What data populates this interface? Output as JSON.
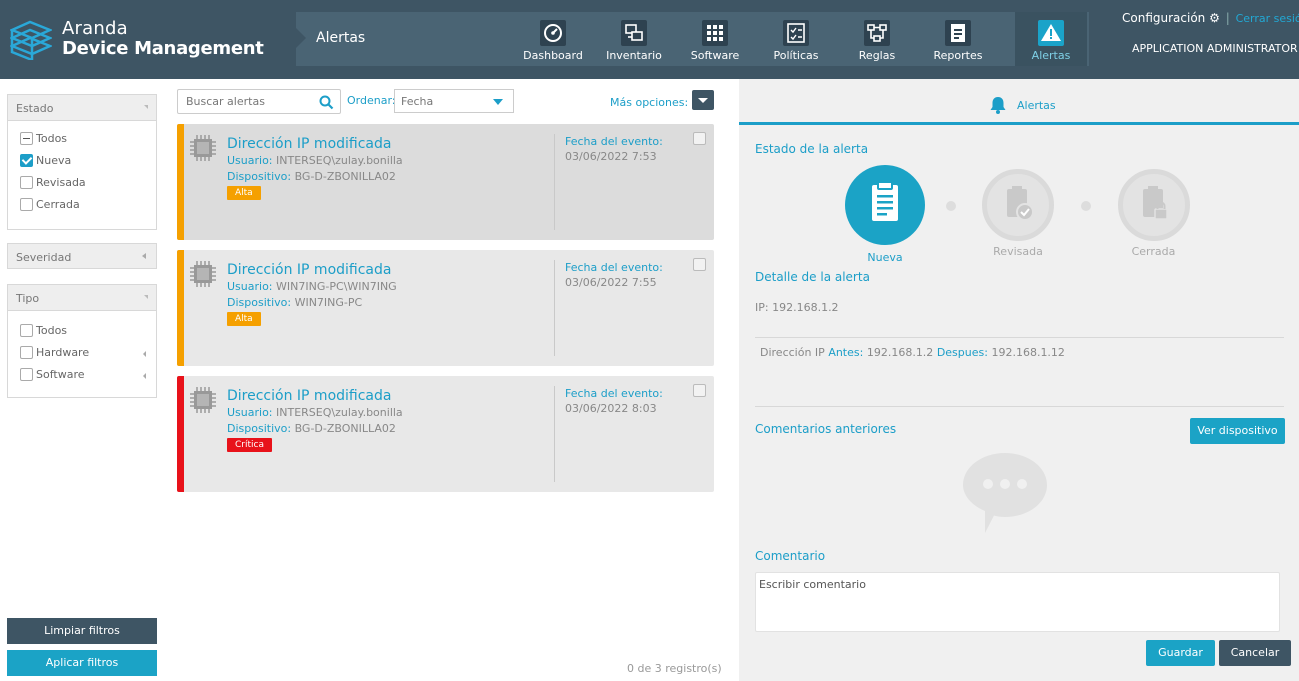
{
  "header": {
    "brand_line1": "Aranda",
    "brand_line2": "Device Management",
    "page_title": "Alertas",
    "nav": [
      {
        "label": "Dashboard",
        "icon": "dashboard-gauge-icon"
      },
      {
        "label": "Inventario",
        "icon": "inventory-computers-icon"
      },
      {
        "label": "Software",
        "icon": "software-grid-icon"
      },
      {
        "label": "Políticas",
        "icon": "policies-checklist-icon"
      },
      {
        "label": "Reglas",
        "icon": "rules-flow-icon"
      },
      {
        "label": "Reportes",
        "icon": "reports-document-icon"
      },
      {
        "label": "Alertas",
        "icon": "alert-warning-icon"
      }
    ],
    "active_nav": "Alertas",
    "config_label": "Configuración",
    "logout_label": "Cerrar sesión",
    "user_role": "APPLICATION ADMINISTRATOR"
  },
  "filters": {
    "estado": {
      "title": "Estado",
      "options": [
        {
          "label": "Todos",
          "state": "partial"
        },
        {
          "label": "Nueva",
          "state": "checked"
        },
        {
          "label": "Revisada",
          "state": "unchecked"
        },
        {
          "label": "Cerrada",
          "state": "unchecked"
        }
      ]
    },
    "severidad": {
      "title": "Severidad"
    },
    "tipo": {
      "title": "Tipo",
      "options": [
        {
          "label": "Todos",
          "state": "unchecked"
        },
        {
          "label": "Hardware",
          "state": "unchecked"
        },
        {
          "label": "Software",
          "state": "unchecked"
        }
      ]
    },
    "clear_label": "Limpiar filtros",
    "apply_label": "Aplicar filtros"
  },
  "list": {
    "search_placeholder": "Buscar alertas",
    "order_label": "Ordenar:",
    "order_value": "Fecha",
    "more_label": "Más opciones:",
    "user_key": "Usuario:",
    "device_key": "Dispositivo:",
    "date_key": "Fecha del evento:",
    "alerts": [
      {
        "title": "Dirección IP modificada",
        "user": "INTERSEQ\\zulay.bonilla",
        "device": "BG-D-ZBONILLA02",
        "severity": "Alta",
        "severity_color": "#f5a000",
        "date": "03/06/2022 7:53"
      },
      {
        "title": "Dirección IP modificada",
        "user": "WIN7ING-PC\\WIN7ING",
        "device": "WIN7ING-PC",
        "severity": "Alta",
        "severity_color": "#f5a000",
        "date": "03/06/2022 7:55"
      },
      {
        "title": "Dirección IP modificada",
        "user": "INTERSEQ\\zulay.bonilla",
        "device": "BG-D-ZBONILLA02",
        "severity": "Crítica",
        "severity_color": "#e8121a",
        "date": "03/06/2022 8:03"
      }
    ],
    "records": "0 de 3 registro(s)"
  },
  "detail": {
    "tab_label": "Alertas",
    "state_title": "Estado de la alerta",
    "steps": [
      {
        "label": "Nueva",
        "status": "current"
      },
      {
        "label": "Revisada",
        "status": "pending"
      },
      {
        "label": "Cerrada",
        "status": "pending"
      }
    ],
    "detail_title": "Detalle de la alerta",
    "ip_line": "IP: 192.168.1.2",
    "change_label": "Dirección IP",
    "before_key": "Antes:",
    "before_value": "192.168.1.2",
    "after_key": "Despues:",
    "after_value": "192.168.1.12",
    "prev_comments_title": "Comentarios anteriores",
    "view_device_label": "Ver dispositivo",
    "comment_title": "Comentario",
    "comment_placeholder": "Escribir comentario",
    "save_label": "Guardar",
    "cancel_label": "Cancelar"
  },
  "colors": {
    "accent": "#1c9ec8",
    "header": "#3e5564",
    "warning": "#f5a000",
    "critical": "#e8121a"
  }
}
